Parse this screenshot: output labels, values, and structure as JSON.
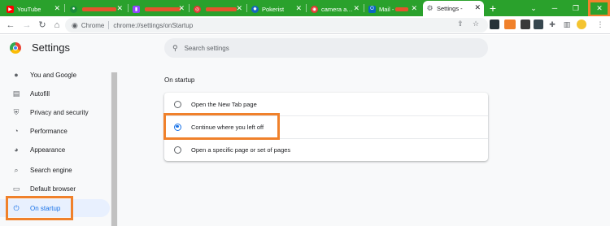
{
  "tabs": [
    {
      "title": "YouTube",
      "fav_color": "#ff0000",
      "fav_glyph": "▶",
      "redacted": false
    },
    {
      "title": "",
      "fav_color": "#1b8d3a",
      "fav_glyph": "●",
      "redacted": true
    },
    {
      "title": "",
      "fav_color": "#9146ff",
      "fav_glyph": "▮",
      "redacted": true
    },
    {
      "title": "",
      "fav_color": "#e53935",
      "fav_glyph": "◎",
      "redacted": true
    },
    {
      "title": "Pokerist",
      "fav_color": "#1565c0",
      "fav_glyph": "✸",
      "redacted": false
    },
    {
      "title": "camera a…",
      "fav_color": "#e53935",
      "fav_glyph": "◉",
      "redacted": false
    },
    {
      "title": "Mail -",
      "fav_color": "#0a66c2",
      "fav_glyph": "O",
      "redacted": true
    }
  ],
  "active_tab": {
    "title": "Settings -"
  },
  "toolbar": {
    "chrome_label": "Chrome",
    "url": "chrome://settings/onStartup"
  },
  "settings": {
    "title": "Settings",
    "search_placeholder": "Search settings"
  },
  "sidebar": {
    "items": [
      {
        "label": "You and Google",
        "icon": "person-icon",
        "glyph": "👤"
      },
      {
        "label": "Autofill",
        "icon": "clipboard-icon",
        "glyph": "▤"
      },
      {
        "label": "Privacy and security",
        "icon": "shield-icon",
        "glyph": "⛨"
      },
      {
        "label": "Performance",
        "icon": "gauge-icon",
        "glyph": "◔"
      },
      {
        "label": "Appearance",
        "icon": "palette-icon",
        "glyph": "◕"
      },
      {
        "label": "Search engine",
        "icon": "search-icon",
        "glyph": "⌕"
      },
      {
        "label": "Default browser",
        "icon": "browser-icon",
        "glyph": "▭"
      },
      {
        "label": "On startup",
        "icon": "power-icon",
        "glyph": "⏻"
      }
    ]
  },
  "startup": {
    "section_title": "On startup",
    "options": [
      {
        "label": "Open the New Tab page",
        "selected": false
      },
      {
        "label": "Continue where you left off",
        "selected": true
      },
      {
        "label": "Open a specific page or set of pages",
        "selected": false
      }
    ]
  },
  "colors": {
    "tabstrip": "#2aa12c",
    "highlight": "#f0812b",
    "accent": "#1a73e8",
    "redaction": "#e5532d"
  }
}
